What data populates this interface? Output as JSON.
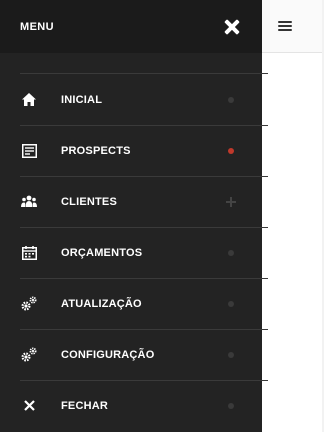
{
  "header": {
    "title": "MENU",
    "close_icon": "close-icon"
  },
  "topbar": {
    "menu_icon": "hamburger-icon"
  },
  "menu": {
    "items": [
      {
        "label": "INICIAL",
        "icon": "home-icon",
        "indicator": "dot"
      },
      {
        "label": "PROSPECTS",
        "icon": "document-icon",
        "indicator": "dot-active"
      },
      {
        "label": "CLIENTES",
        "icon": "users-icon",
        "indicator": "plus"
      },
      {
        "label": "ORÇAMENTOS",
        "icon": "calendar-icon",
        "indicator": "dot"
      },
      {
        "label": "ATUALIZAÇÃO",
        "icon": "gears-icon",
        "indicator": "dot"
      },
      {
        "label": "CONFIGURAÇÃO",
        "icon": "gears-icon",
        "indicator": "dot"
      },
      {
        "label": "FECHAR",
        "icon": "close-icon",
        "indicator": "dot"
      }
    ]
  },
  "colors": {
    "drawer_bg": "#232323",
    "header_bg": "#1b1b1b",
    "accent_dot": "#c0392b"
  }
}
